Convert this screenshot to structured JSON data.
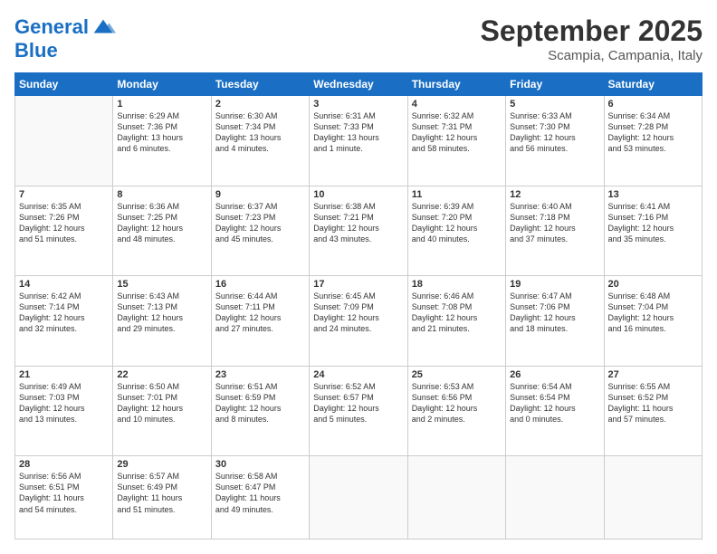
{
  "logo": {
    "line1": "General",
    "line2": "Blue"
  },
  "title": "September 2025",
  "location": "Scampia, Campania, Italy",
  "headers": [
    "Sunday",
    "Monday",
    "Tuesday",
    "Wednesday",
    "Thursday",
    "Friday",
    "Saturday"
  ],
  "weeks": [
    [
      {
        "day": "",
        "text": ""
      },
      {
        "day": "1",
        "text": "Sunrise: 6:29 AM\nSunset: 7:36 PM\nDaylight: 13 hours\nand 6 minutes."
      },
      {
        "day": "2",
        "text": "Sunrise: 6:30 AM\nSunset: 7:34 PM\nDaylight: 13 hours\nand 4 minutes."
      },
      {
        "day": "3",
        "text": "Sunrise: 6:31 AM\nSunset: 7:33 PM\nDaylight: 13 hours\nand 1 minute."
      },
      {
        "day": "4",
        "text": "Sunrise: 6:32 AM\nSunset: 7:31 PM\nDaylight: 12 hours\nand 58 minutes."
      },
      {
        "day": "5",
        "text": "Sunrise: 6:33 AM\nSunset: 7:30 PM\nDaylight: 12 hours\nand 56 minutes."
      },
      {
        "day": "6",
        "text": "Sunrise: 6:34 AM\nSunset: 7:28 PM\nDaylight: 12 hours\nand 53 minutes."
      }
    ],
    [
      {
        "day": "7",
        "text": "Sunrise: 6:35 AM\nSunset: 7:26 PM\nDaylight: 12 hours\nand 51 minutes."
      },
      {
        "day": "8",
        "text": "Sunrise: 6:36 AM\nSunset: 7:25 PM\nDaylight: 12 hours\nand 48 minutes."
      },
      {
        "day": "9",
        "text": "Sunrise: 6:37 AM\nSunset: 7:23 PM\nDaylight: 12 hours\nand 45 minutes."
      },
      {
        "day": "10",
        "text": "Sunrise: 6:38 AM\nSunset: 7:21 PM\nDaylight: 12 hours\nand 43 minutes."
      },
      {
        "day": "11",
        "text": "Sunrise: 6:39 AM\nSunset: 7:20 PM\nDaylight: 12 hours\nand 40 minutes."
      },
      {
        "day": "12",
        "text": "Sunrise: 6:40 AM\nSunset: 7:18 PM\nDaylight: 12 hours\nand 37 minutes."
      },
      {
        "day": "13",
        "text": "Sunrise: 6:41 AM\nSunset: 7:16 PM\nDaylight: 12 hours\nand 35 minutes."
      }
    ],
    [
      {
        "day": "14",
        "text": "Sunrise: 6:42 AM\nSunset: 7:14 PM\nDaylight: 12 hours\nand 32 minutes."
      },
      {
        "day": "15",
        "text": "Sunrise: 6:43 AM\nSunset: 7:13 PM\nDaylight: 12 hours\nand 29 minutes."
      },
      {
        "day": "16",
        "text": "Sunrise: 6:44 AM\nSunset: 7:11 PM\nDaylight: 12 hours\nand 27 minutes."
      },
      {
        "day": "17",
        "text": "Sunrise: 6:45 AM\nSunset: 7:09 PM\nDaylight: 12 hours\nand 24 minutes."
      },
      {
        "day": "18",
        "text": "Sunrise: 6:46 AM\nSunset: 7:08 PM\nDaylight: 12 hours\nand 21 minutes."
      },
      {
        "day": "19",
        "text": "Sunrise: 6:47 AM\nSunset: 7:06 PM\nDaylight: 12 hours\nand 18 minutes."
      },
      {
        "day": "20",
        "text": "Sunrise: 6:48 AM\nSunset: 7:04 PM\nDaylight: 12 hours\nand 16 minutes."
      }
    ],
    [
      {
        "day": "21",
        "text": "Sunrise: 6:49 AM\nSunset: 7:03 PM\nDaylight: 12 hours\nand 13 minutes."
      },
      {
        "day": "22",
        "text": "Sunrise: 6:50 AM\nSunset: 7:01 PM\nDaylight: 12 hours\nand 10 minutes."
      },
      {
        "day": "23",
        "text": "Sunrise: 6:51 AM\nSunset: 6:59 PM\nDaylight: 12 hours\nand 8 minutes."
      },
      {
        "day": "24",
        "text": "Sunrise: 6:52 AM\nSunset: 6:57 PM\nDaylight: 12 hours\nand 5 minutes."
      },
      {
        "day": "25",
        "text": "Sunrise: 6:53 AM\nSunset: 6:56 PM\nDaylight: 12 hours\nand 2 minutes."
      },
      {
        "day": "26",
        "text": "Sunrise: 6:54 AM\nSunset: 6:54 PM\nDaylight: 12 hours\nand 0 minutes."
      },
      {
        "day": "27",
        "text": "Sunrise: 6:55 AM\nSunset: 6:52 PM\nDaylight: 11 hours\nand 57 minutes."
      }
    ],
    [
      {
        "day": "28",
        "text": "Sunrise: 6:56 AM\nSunset: 6:51 PM\nDaylight: 11 hours\nand 54 minutes."
      },
      {
        "day": "29",
        "text": "Sunrise: 6:57 AM\nSunset: 6:49 PM\nDaylight: 11 hours\nand 51 minutes."
      },
      {
        "day": "30",
        "text": "Sunrise: 6:58 AM\nSunset: 6:47 PM\nDaylight: 11 hours\nand 49 minutes."
      },
      {
        "day": "",
        "text": ""
      },
      {
        "day": "",
        "text": ""
      },
      {
        "day": "",
        "text": ""
      },
      {
        "day": "",
        "text": ""
      }
    ]
  ]
}
